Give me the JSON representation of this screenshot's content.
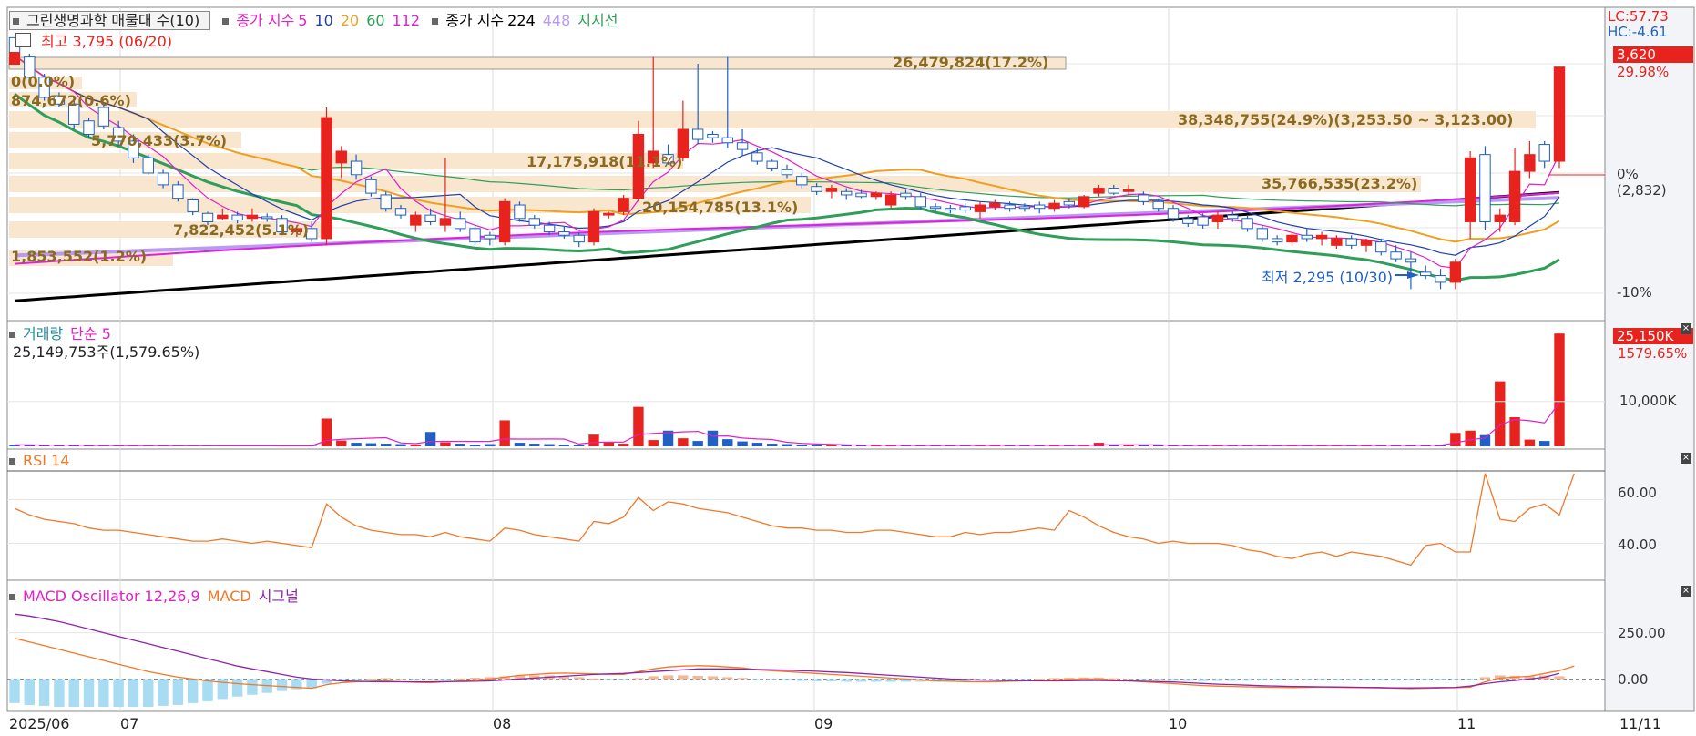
{
  "main": {
    "title": "그린생명과학 매물대 수(10)",
    "ma_legend": {
      "label": "종가 지수",
      "p5": "5",
      "p10": "10",
      "p20": "20",
      "p60": "60",
      "p112": "112"
    },
    "ma_legend2": {
      "label": "종가 지수",
      "p224": "224",
      "p448": "448",
      "support": "지지선"
    },
    "high_label": "최고 3,795 (06/20)",
    "low_label": "최저 2,295 (10/30)",
    "lc": "LC:57.73",
    "hc": "HC:-4.61",
    "price_tag": "3,620",
    "price_pct": "29.98%",
    "zero_pct": "0%",
    "zero_val": "(2,832)",
    "minus10": "-10%"
  },
  "volume": {
    "title": "거래량",
    "ma": "단순 5",
    "total": "25,149,753주(1,579.65%)",
    "tag": "25,150K",
    "tag_pct": "1579.65%",
    "axis_label": "10,000K"
  },
  "rsi": {
    "title": "RSI 14",
    "axis": [
      "60.00",
      "40.00"
    ]
  },
  "macd": {
    "title_osc": "MACD Oscillator 12,26,9",
    "title_macd": "MACD",
    "title_signal": "시그널",
    "axis": [
      "250.00",
      "0.00"
    ]
  },
  "xaxis": {
    "labels": [
      "2025/06",
      "07",
      "08",
      "09",
      "10",
      "11"
    ],
    "end": "11/11"
  },
  "colors": {
    "up": "#e8231e",
    "down": "#1f5fc6",
    "ma5": "#e020c8",
    "ma10": "#1f3fae",
    "ma20": "#f0a020",
    "ma60": "#2e9e58",
    "ma112": "#e020e0",
    "ma224": "#000000",
    "ma448": "#b89bf0",
    "support": "#2e9e58",
    "band": "#f8e6cf"
  },
  "chart_data": [
    {
      "type": "candlestick",
      "title": "그린생명과학 매물대 수(10)",
      "price_range": [
        2150,
        3900
      ],
      "high": {
        "value": 3795,
        "date": "06/20"
      },
      "low": {
        "value": 2295,
        "date": "10/30"
      },
      "last_close": 3620,
      "change_pct": 29.98,
      "reference": 2832,
      "candles": [
        [
          3795,
          3795,
          3660,
          3690
        ],
        [
          3680,
          3700,
          3540,
          3560
        ],
        [
          3560,
          3580,
          3420,
          3440
        ],
        [
          3450,
          3470,
          3380,
          3400
        ],
        [
          3400,
          3450,
          3250,
          3280
        ],
        [
          3300,
          3320,
          3200,
          3220
        ],
        [
          3380,
          3400,
          3250,
          3270
        ],
        [
          3260,
          3300,
          3150,
          3180
        ],
        [
          3180,
          3220,
          3050,
          3080
        ],
        [
          3080,
          3100,
          2980,
          2990
        ],
        [
          2990,
          3010,
          2900,
          2920
        ],
        [
          2920,
          2940,
          2820,
          2840
        ],
        [
          2830,
          2840,
          2740,
          2760
        ],
        [
          2750,
          2760,
          2680,
          2700
        ],
        [
          2720,
          2780,
          2710,
          2740
        ],
        [
          2740,
          2760,
          2690,
          2710
        ],
        [
          2720,
          2780,
          2700,
          2740
        ],
        [
          2730,
          2750,
          2700,
          2720
        ],
        [
          2720,
          2740,
          2620,
          2640
        ],
        [
          2640,
          2680,
          2610,
          2660
        ],
        [
          2660,
          2700,
          2580,
          2600
        ],
        [
          2600,
          3380,
          2560,
          3320
        ],
        [
          3050,
          3150,
          2960,
          3120
        ],
        [
          3060,
          3100,
          2950,
          2980
        ],
        [
          2950,
          2970,
          2850,
          2870
        ],
        [
          2860,
          2880,
          2760,
          2780
        ],
        [
          2780,
          2800,
          2720,
          2740
        ],
        [
          2680,
          2760,
          2640,
          2740
        ],
        [
          2740,
          2780,
          2680,
          2700
        ],
        [
          2680,
          3080,
          2640,
          2720
        ],
        [
          2720,
          2760,
          2640,
          2660
        ],
        [
          2660,
          2680,
          2560,
          2580
        ],
        [
          2620,
          2640,
          2560,
          2600
        ],
        [
          2580,
          2840,
          2560,
          2820
        ],
        [
          2800,
          2820,
          2700,
          2720
        ],
        [
          2720,
          2740,
          2660,
          2680
        ],
        [
          2680,
          2700,
          2620,
          2640
        ],
        [
          2640,
          2670,
          2600,
          2620
        ],
        [
          2620,
          2640,
          2550,
          2580
        ],
        [
          2580,
          2780,
          2560,
          2760
        ],
        [
          2740,
          2760,
          2720,
          2750
        ],
        [
          2760,
          2860,
          2740,
          2840
        ],
        [
          2840,
          3300,
          2820,
          3220
        ],
        [
          3050,
          3680,
          3020,
          3120
        ],
        [
          3100,
          3160,
          3040,
          3050
        ],
        [
          3080,
          3420,
          3060,
          3250
        ],
        [
          3250,
          3640,
          3160,
          3190
        ],
        [
          3220,
          3240,
          3170,
          3200
        ],
        [
          3200,
          3680,
          3140,
          3170
        ],
        [
          3170,
          3250,
          3090,
          3130
        ],
        [
          3110,
          3140,
          3040,
          3060
        ],
        [
          3060,
          3070,
          3000,
          3020
        ],
        [
          3010,
          3040,
          2960,
          2980
        ],
        [
          2970,
          2990,
          2900,
          2920
        ],
        [
          2910,
          2930,
          2860,
          2880
        ],
        [
          2880,
          2920,
          2840,
          2900
        ],
        [
          2880,
          2900,
          2830,
          2860
        ],
        [
          2870,
          2890,
          2840,
          2850
        ],
        [
          2850,
          2880,
          2830,
          2870
        ],
        [
          2800,
          2880,
          2780,
          2860
        ],
        [
          2870,
          2890,
          2830,
          2850
        ],
        [
          2850,
          2870,
          2770,
          2790
        ],
        [
          2790,
          2810,
          2760,
          2780
        ],
        [
          2780,
          2800,
          2750,
          2770
        ],
        [
          2790,
          2810,
          2750,
          2770
        ],
        [
          2760,
          2820,
          2720,
          2800
        ],
        [
          2790,
          2830,
          2770,
          2810
        ],
        [
          2800,
          2820,
          2760,
          2780
        ],
        [
          2790,
          2810,
          2760,
          2780
        ],
        [
          2800,
          2820,
          2750,
          2780
        ],
        [
          2780,
          2830,
          2760,
          2810
        ],
        [
          2820,
          2840,
          2780,
          2800
        ],
        [
          2790,
          2860,
          2780,
          2850
        ],
        [
          2870,
          2920,
          2850,
          2900
        ],
        [
          2900,
          2920,
          2860,
          2870
        ],
        [
          2880,
          2920,
          2860,
          2890
        ],
        [
          2860,
          2880,
          2800,
          2820
        ],
        [
          2820,
          2840,
          2760,
          2780
        ],
        [
          2780,
          2800,
          2700,
          2720
        ],
        [
          2720,
          2740,
          2670,
          2690
        ],
        [
          2730,
          2750,
          2660,
          2680
        ],
        [
          2700,
          2760,
          2660,
          2740
        ],
        [
          2740,
          2760,
          2700,
          2720
        ],
        [
          2720,
          2740,
          2640,
          2660
        ],
        [
          2660,
          2680,
          2580,
          2600
        ],
        [
          2600,
          2620,
          2560,
          2580
        ],
        [
          2580,
          2640,
          2560,
          2620
        ],
        [
          2620,
          2660,
          2580,
          2600
        ],
        [
          2600,
          2640,
          2560,
          2620
        ],
        [
          2560,
          2620,
          2540,
          2600
        ],
        [
          2600,
          2620,
          2540,
          2560
        ],
        [
          2560,
          2600,
          2520,
          2590
        ],
        [
          2580,
          2600,
          2500,
          2520
        ],
        [
          2520,
          2560,
          2460,
          2480
        ],
        [
          2480,
          2520,
          2300,
          2460
        ],
        [
          2400,
          2440,
          2360,
          2380
        ],
        [
          2380,
          2420,
          2300,
          2340
        ],
        [
          2340,
          2480,
          2300,
          2460
        ],
        [
          2700,
          3120,
          2600,
          3080
        ],
        [
          3100,
          3150,
          2650,
          2700
        ],
        [
          2700,
          2780,
          2640,
          2740
        ],
        [
          2700,
          3140,
          2680,
          3000
        ],
        [
          3000,
          3180,
          2960,
          3100
        ],
        [
          3160,
          3180,
          3020,
          3060
        ],
        [
          3060,
          3620,
          3020,
          3620
        ]
      ]
    },
    {
      "type": "bar",
      "title": "거래량",
      "unit": "K",
      "last": 25150,
      "last_pct": 1579.65,
      "values": [
        350,
        280,
        250,
        200,
        220,
        200,
        180,
        150,
        160,
        140,
        150,
        130,
        130,
        120,
        120,
        110,
        110,
        100,
        100,
        100,
        120,
        6200,
        1300,
        800,
        700,
        600,
        500,
        400,
        3200,
        900,
        600,
        400,
        500,
        5800,
        800,
        600,
        500,
        400,
        300,
        2600,
        900,
        600,
        8800,
        1400,
        3500,
        1800,
        1200,
        3500,
        1600,
        1100,
        800,
        600,
        500,
        400,
        300,
        300,
        250,
        220,
        200,
        200,
        220,
        200,
        180,
        200,
        220,
        240,
        250,
        200,
        220,
        200,
        200,
        200,
        200,
        800,
        260,
        240,
        220,
        200,
        200,
        200,
        200,
        200,
        200,
        180,
        180,
        170,
        170,
        170,
        200,
        200,
        190,
        300,
        220,
        200,
        210,
        250,
        240,
        3000,
        3500,
        2500,
        14500,
        6500,
        1500,
        1200,
        25150
      ]
    },
    {
      "type": "line",
      "title": "RSI 14",
      "y_ticks": [
        40,
        60
      ],
      "values": [
        56,
        53,
        51,
        50,
        49,
        47,
        46,
        46,
        45,
        44,
        43,
        42,
        41,
        41,
        42,
        41,
        40,
        41,
        40,
        39,
        38,
        58,
        52,
        48,
        46,
        45,
        44,
        44,
        43,
        45,
        43,
        42,
        41,
        47,
        46,
        44,
        43,
        42,
        41,
        50,
        49,
        52,
        61,
        55,
        59,
        58,
        56,
        55,
        54,
        52,
        50,
        48,
        47,
        47,
        46,
        46,
        45,
        45,
        46,
        46,
        45,
        44,
        43,
        43,
        45,
        44,
        45,
        45,
        46,
        47,
        46,
        55,
        52,
        48,
        45,
        43,
        42,
        40,
        41,
        40,
        40,
        40,
        39,
        37,
        36,
        34,
        33,
        35,
        36,
        34,
        36,
        35,
        34,
        32,
        30,
        39,
        40,
        36,
        36,
        72,
        51,
        50,
        56,
        58,
        53,
        72
      ]
    },
    {
      "type": "bar",
      "title": "MACD Oscillator 12,26,9",
      "series": [
        {
          "name": "MACD",
          "values": [
            220,
            200,
            180,
            160,
            140,
            120,
            100,
            80,
            60,
            40,
            25,
            10,
            0,
            -10,
            -18,
            -25,
            -30,
            -35,
            -40,
            -45,
            -50,
            -30,
            -20,
            -15,
            -12,
            -10,
            -15,
            -18,
            -20,
            -15,
            -10,
            -5,
            0,
            10,
            20,
            25,
            30,
            32,
            30,
            28,
            26,
            25,
            40,
            55,
            65,
            70,
            72,
            70,
            65,
            60,
            50,
            45,
            40,
            35,
            30,
            25,
            20,
            15,
            10,
            5,
            0,
            -5,
            -10,
            -12,
            -14,
            -15,
            -15,
            -12,
            -10,
            -8,
            -5,
            -2,
            0,
            0,
            -5,
            -10,
            -15,
            -20,
            -25,
            -30,
            -35,
            -38,
            -40,
            -42,
            -44,
            -45,
            -46,
            -45,
            -44,
            -45,
            -46,
            -47,
            -48,
            -50,
            -52,
            -50,
            -48,
            -47,
            -44,
            -15,
            5,
            10,
            15,
            30,
            45,
            70
          ]
        },
        {
          "name": "시그널",
          "values": [
            350,
            340,
            325,
            310,
            290,
            270,
            250,
            230,
            210,
            190,
            170,
            150,
            130,
            110,
            90,
            70,
            55,
            40,
            25,
            10,
            0,
            -5,
            -10,
            -12,
            -14,
            -15,
            -15,
            -15,
            -15,
            -14,
            -13,
            -12,
            -10,
            -5,
            0,
            5,
            10,
            15,
            20,
            25,
            28,
            30,
            35,
            40,
            45,
            50,
            55,
            55,
            55,
            54,
            52,
            50,
            48,
            45,
            42,
            38,
            35,
            30,
            25,
            20,
            15,
            10,
            5,
            0,
            -2,
            -5,
            -7,
            -8,
            -9,
            -10,
            -10,
            -9,
            -8,
            -8,
            -9,
            -10,
            -12,
            -14,
            -16,
            -20,
            -24,
            -28,
            -30,
            -33,
            -36,
            -38,
            -40,
            -41,
            -42,
            -43,
            -44,
            -45,
            -46,
            -48,
            -48,
            -47,
            -46,
            -45,
            -38,
            -25,
            -15,
            -8,
            0,
            10,
            30
          ]
        }
      ]
    }
  ],
  "volume_bands": [
    {
      "label": "26,479,824(17.2%)"
    },
    {
      "label": "38,348,755(24.9%)(3,253.50 ~ 3,123.00)"
    },
    {
      "label": "35,766,535(23.2%)"
    },
    {
      "label": "20,154,785(13.1%)"
    },
    {
      "label": "17,175,918(11.1%)"
    },
    {
      "label": "5,770,433(3.7%)"
    },
    {
      "label": "7,822,452(5.1%)"
    },
    {
      "label": "1,853,552(1.2%)"
    },
    {
      "label": "874,672(0.6%)"
    },
    {
      "label": "0(0.0%)"
    }
  ]
}
